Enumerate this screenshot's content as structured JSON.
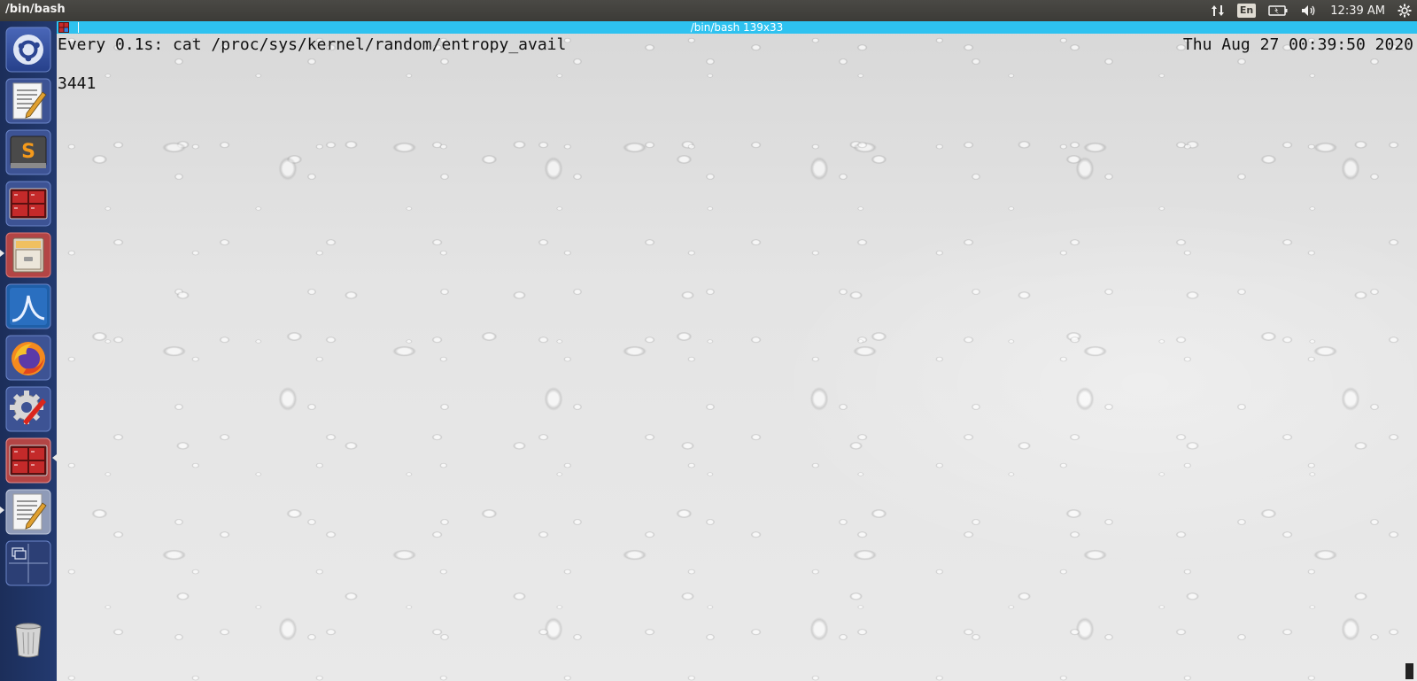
{
  "top_panel": {
    "app_title": "/bin/bash",
    "language": "En",
    "clock": "12:39 AM"
  },
  "launcher": {
    "items": [
      {
        "name": "dash-home",
        "icon": "ubuntu-logo-icon"
      },
      {
        "name": "text-editor",
        "icon": "text-editor-icon"
      },
      {
        "name": "sublime-text",
        "icon": "sublime-text-icon"
      },
      {
        "name": "terminal-grid",
        "icon": "terminal-grid-icon"
      },
      {
        "name": "file-cabinet",
        "icon": "file-cabinet-icon"
      },
      {
        "name": "wireshark",
        "icon": "wireshark-icon"
      },
      {
        "name": "firefox",
        "icon": "firefox-icon"
      },
      {
        "name": "system-settings",
        "icon": "settings-gear-icon"
      },
      {
        "name": "terminal-grid-active",
        "icon": "terminal-grid-icon"
      },
      {
        "name": "text-editor-2",
        "icon": "text-editor-icon"
      },
      {
        "name": "workspace-switcher",
        "icon": "workspace-switcher-icon"
      },
      {
        "name": "trash",
        "icon": "trash-icon"
      }
    ]
  },
  "terminal": {
    "window_title": "/bin/bash 139x33",
    "watch_header": "Every 0.1s: cat /proc/sys/kernel/random/entropy_avail",
    "timestamp": "Thu Aug 27 00:39:50 2020",
    "output": "3441"
  },
  "colors": {
    "titlebar_accent": "#2ec2f0",
    "launcher_bg": "#1c2e5a",
    "panel_bg": "#3c3b37"
  }
}
